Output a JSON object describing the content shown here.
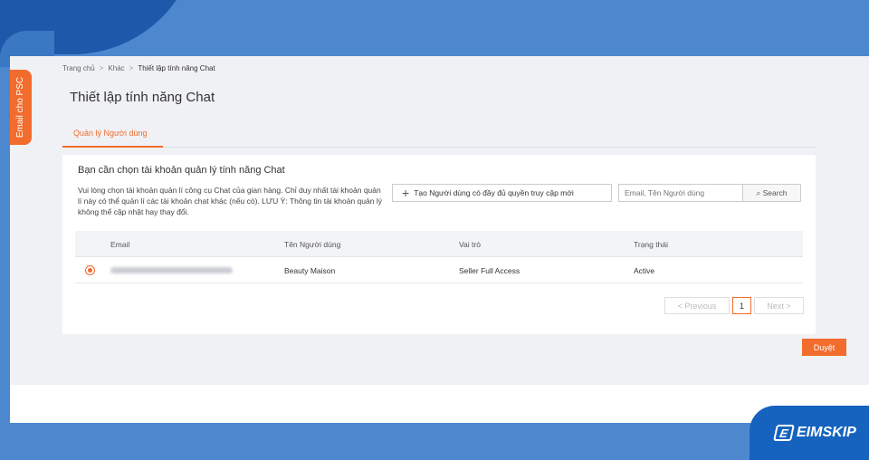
{
  "side_tab": "Email cho PSC",
  "breadcrumb": [
    "Trang chủ",
    "Khác",
    "Thiết lập tính năng Chat"
  ],
  "page_title": "Thiết lập tính năng Chat",
  "tabs": [
    {
      "label": "Quản lý Người dùng",
      "active": true
    }
  ],
  "card": {
    "heading": "Bạn cần chọn tài khoản quản lý tính năng Chat",
    "description": "Vui lòng chọn tài khoản quản lí công cụ Chat của gian hàng. Chỉ duy nhất tài khoản quản lí này có thể quản lí các tài khoản chat khác (nếu có). LƯU Ý: Thông tin tài khoản quản lý không thể cập nhật hay thay đổi.",
    "create_button": "Tạo Người dùng có đầy đủ quyền truy cập mới",
    "search_placeholder": "Email, Tên Người dùng",
    "search_button": "Search"
  },
  "table": {
    "columns": [
      "Email",
      "Tên Người dùng",
      "Vai trò",
      "Trạng thái"
    ],
    "rows": [
      {
        "selected": true,
        "name": "Beauty Maison",
        "role": "Seller Full Access",
        "status": "Active"
      }
    ]
  },
  "pagination": {
    "previous": "< Previous",
    "current": "1",
    "next": "Next >"
  },
  "approve_button": "Duyệt",
  "logo": "EIMSKIP",
  "colors": {
    "accent": "#f26c2d",
    "background": "#4d88cf",
    "logo_bg": "#1663bf"
  }
}
